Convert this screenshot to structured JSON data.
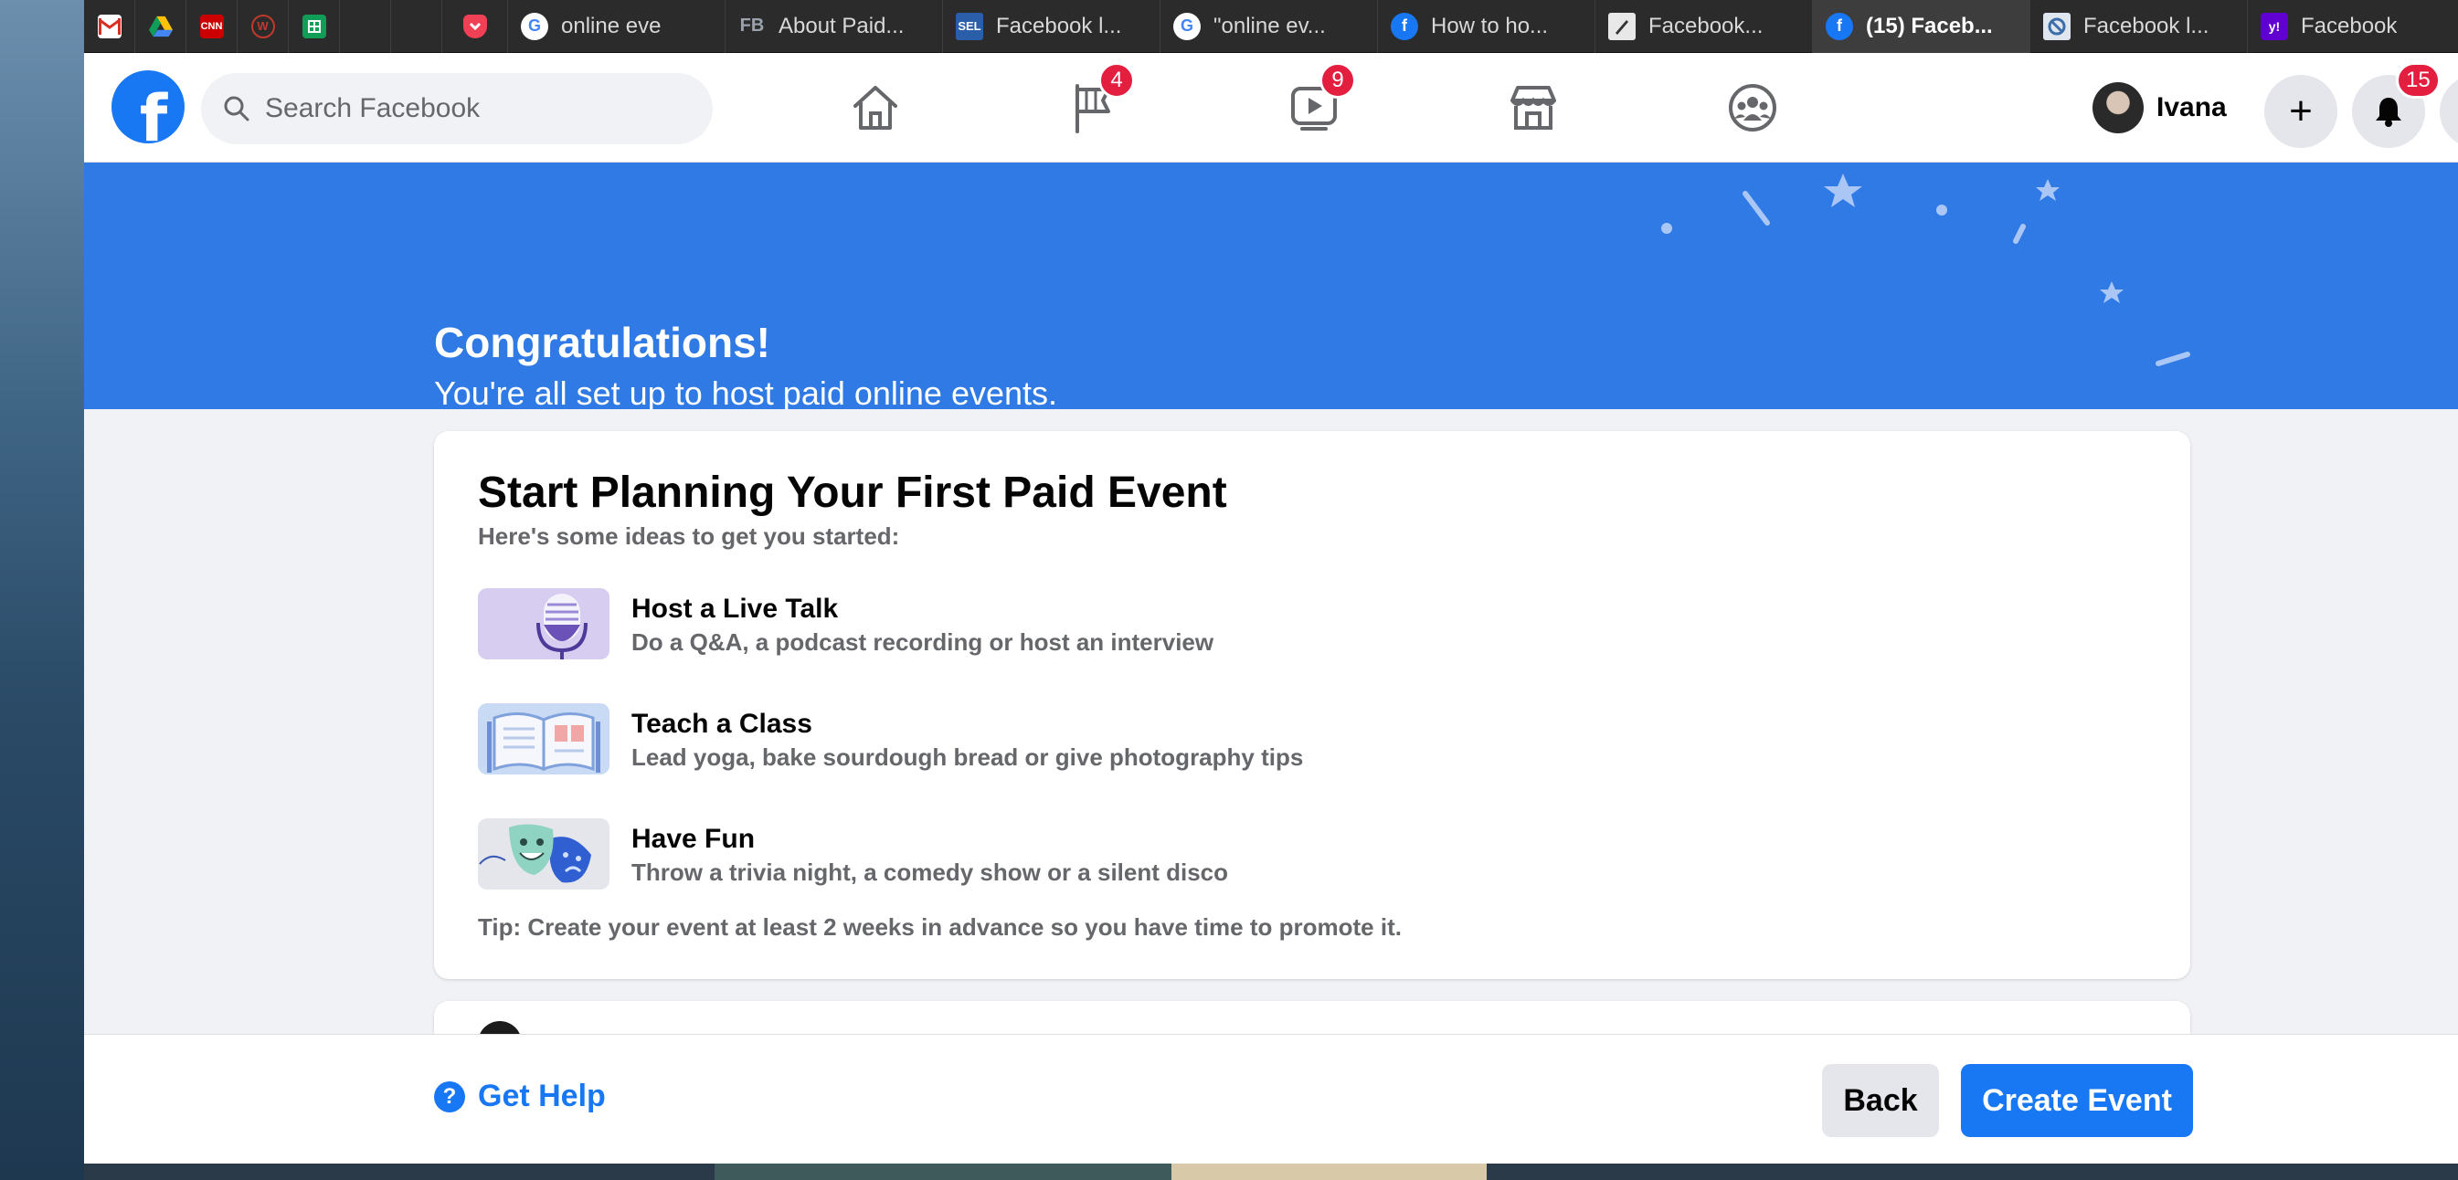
{
  "tabs": [
    {
      "title": "online eve",
      "favicon": "G",
      "active": false
    },
    {
      "title": "About Paid...",
      "favicon": "FB",
      "active": false
    },
    {
      "title": "Facebook l...",
      "favicon": "SEL",
      "active": false
    },
    {
      "title": "\"online ev...",
      "favicon": "G",
      "active": false
    },
    {
      "title": "How to ho...",
      "favicon": "f",
      "active": false
    },
    {
      "title": "Facebook...",
      "favicon": "",
      "active": false
    },
    {
      "title": "(15) Faceb...",
      "favicon": "f",
      "active": true
    },
    {
      "title": "Facebook l...",
      "favicon": "",
      "active": false
    },
    {
      "title": "Facebook",
      "favicon": "y!",
      "active": false
    }
  ],
  "pinned_tabs": [
    "gmail-icon",
    "drive-icon",
    "cnn-icon",
    "wordpress-icon",
    "sheets-icon",
    "blank-tab-icon",
    "blank-tab-icon",
    "pocket-icon"
  ],
  "header": {
    "logo": "f",
    "search_placeholder": "Search Facebook",
    "nav": [
      {
        "icon": "home-icon",
        "badge": ""
      },
      {
        "icon": "pages-flag-icon",
        "badge": "4"
      },
      {
        "icon": "watch-video-icon",
        "badge": "9"
      },
      {
        "icon": "marketplace-icon",
        "badge": ""
      },
      {
        "icon": "groups-icon",
        "badge": ""
      }
    ],
    "user_name": "Ivana",
    "create_label": "+",
    "notifications_badge": "15"
  },
  "banner": {
    "title": "Congratulations!",
    "subtitle": "You're all set up to host paid online events."
  },
  "card": {
    "title": "Start Planning Your First Paid Event",
    "subtitle": "Here's some ideas to get you started:",
    "ideas": [
      {
        "title": "Host a Live Talk",
        "desc": "Do a Q&A, a podcast recording or host an interview",
        "icon": "microphone-icon"
      },
      {
        "title": "Teach a Class",
        "desc": "Lead yoga, bake sourdough bread or give photography tips",
        "icon": "open-book-icon"
      },
      {
        "title": "Have Fun",
        "desc": "Throw a trivia night, a comedy show or a silent disco",
        "icon": "theater-masks-icon"
      }
    ],
    "tip": "Tip: Create your event at least 2 weeks in advance so you have time to promote it."
  },
  "footer": {
    "help_label": "Get Help",
    "back_label": "Back",
    "create_label": "Create Event"
  },
  "colors": {
    "brand_blue": "#1877f2",
    "banner_blue": "#2f7ae5",
    "badge_red": "#e41e3f",
    "secondary_text": "#65676b"
  }
}
